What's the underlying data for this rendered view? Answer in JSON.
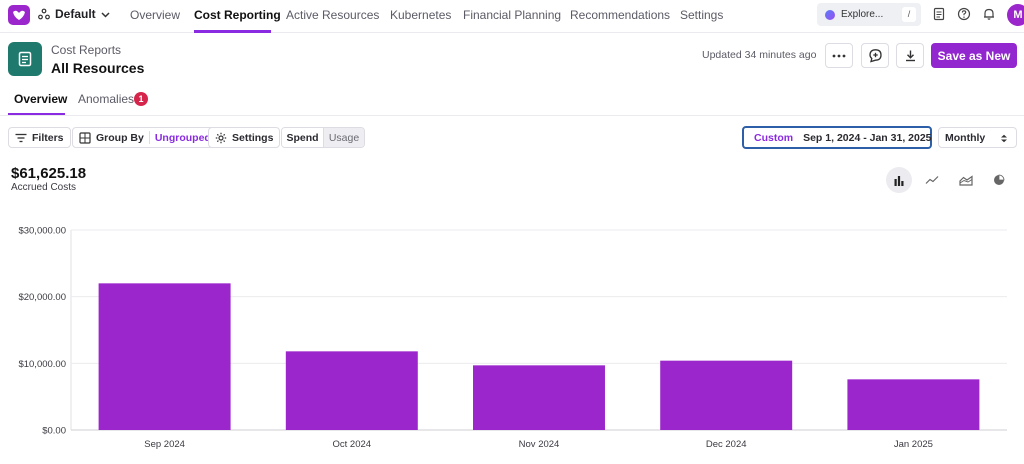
{
  "nav": {
    "workspace": "Default",
    "tabs": [
      "Overview",
      "Cost Reporting",
      "Active Resources",
      "Kubernetes",
      "Financial Planning",
      "Recommendations",
      "Settings"
    ],
    "active_tab": "Cost Reporting",
    "explore_placeholder": "Explore...",
    "explore_shortcut": "/",
    "avatar_initial": "M"
  },
  "header": {
    "breadcrumb": "Cost Reports",
    "title": "All Resources",
    "updated": "Updated 34 minutes ago",
    "save_label": "Save as New"
  },
  "subtabs": {
    "overview": "Overview",
    "anomalies": "Anomalies",
    "anomalies_count": "1"
  },
  "toolbar": {
    "filters": "Filters",
    "group_by_label": "Group By",
    "group_by_value": "Ungrouped",
    "settings": "Settings",
    "spend": "Spend",
    "usage": "Usage",
    "date_mode": "Custom",
    "date_range": "Sep 1, 2024 - Jan 31, 2025",
    "interval": "Monthly"
  },
  "summary": {
    "total": "$61,625.18",
    "label": "Accrued Costs"
  },
  "chart_types": [
    "bar-chart-icon",
    "line-chart-icon",
    "area-chart-icon",
    "pie-chart-icon"
  ],
  "colors": {
    "accent": "#8a2be2",
    "bar": "#9b27cc",
    "save_button": "#9227cf",
    "page_icon": "#1f7a6d",
    "badge": "#d6254a"
  },
  "chart_data": {
    "type": "bar",
    "categories": [
      "Sep 2024",
      "Oct 2024",
      "Nov 2024",
      "Dec 2024",
      "Jan 2025"
    ],
    "values": [
      22000,
      11800,
      9700,
      10400,
      7600
    ],
    "ylim": [
      0,
      30000
    ],
    "yticks": [
      0,
      10000,
      20000,
      30000
    ],
    "ytick_labels": [
      "$0.00",
      "$10,000.00",
      "$20,000.00",
      "$30,000.00"
    ],
    "grid": true
  }
}
